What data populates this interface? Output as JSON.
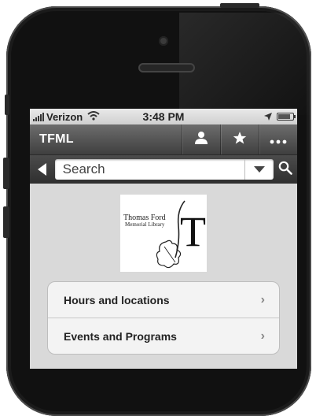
{
  "status_bar": {
    "carrier": "Verizon",
    "time": "3:48 PM"
  },
  "nav_bar": {
    "title": "TFML",
    "icons": [
      "user-icon",
      "star-icon",
      "more-icon"
    ]
  },
  "search_bar": {
    "placeholder": "Search"
  },
  "logo": {
    "line1": "Thomas Ford",
    "line2": "Memorial Library",
    "letter": "T"
  },
  "menu": {
    "items": [
      {
        "label": "Hours and locations"
      },
      {
        "label": "Events and Programs"
      }
    ]
  }
}
